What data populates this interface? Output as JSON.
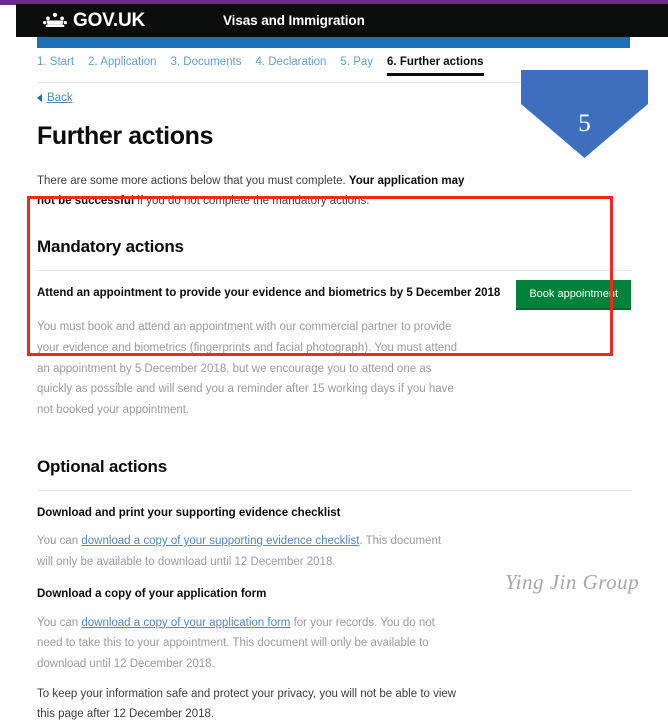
{
  "header": {
    "brand": "GOV.UK",
    "crown_icon": "crown-icon",
    "service_title": "Visas and Immigration"
  },
  "step_nav": {
    "steps": [
      {
        "label": "1. Start",
        "current": false
      },
      {
        "label": "2. Application",
        "current": false
      },
      {
        "label": "3. Documents",
        "current": false
      },
      {
        "label": "4. Declaration",
        "current": false
      },
      {
        "label": "5. Pay",
        "current": false
      },
      {
        "label": "6. Further actions",
        "current": true
      }
    ]
  },
  "back": {
    "label": "Back",
    "caret_icon": "back-caret-icon"
  },
  "main": {
    "page_title": "Further actions",
    "intro_lead": "There are some more actions below that you must complete. ",
    "intro_bold": "Your application may not be successful",
    "intro_tail": " if you do not complete the mandatory actions."
  },
  "mandatory": {
    "section_title": "Mandatory actions",
    "action_title": "Attend an appointment to provide your evidence and biometrics by 5 December 2018",
    "action_body": "You must book and attend an appointment with our commercial partner to provide your evidence and biometrics (fingerprints and facial photograph). You must attend an appointment by 5 December 2018, but we encourage you to attend one as quickly as possible and will send you a reminder after 15 working days if you have not booked your appointment.",
    "button_label": "Book appointment"
  },
  "optional": {
    "section_title": "Optional actions",
    "items": [
      {
        "title": "Download and print your supporting evidence checklist",
        "body_pre": "You can ",
        "link": "download a copy of your supporting evidence checklist",
        "body_post": ". This document will only be available to download until 12 December 2018."
      },
      {
        "title": "Download a copy of your application form",
        "body_pre": "You can ",
        "link": "download a copy of your application form",
        "body_post": " for your records. You do not need to take this to your appointment. This document will only be available to download until 12 December 2018."
      }
    ],
    "privacy_note": "To keep your information safe and protect your privacy, you will not be able to view this page after 12 December 2018."
  },
  "annotations": {
    "chevron_number": "5",
    "chevron_color": "#3e6fbd",
    "red_box_color": "#f0281e",
    "watermark": "Ying Jin Group"
  },
  "colors": {
    "govuk_black": "#0b0c0c",
    "blue_band": "#1d70b8",
    "purple_sliver": "#6b2d8b",
    "green_button": "#00823b",
    "link_blue": "#4f86c6"
  }
}
